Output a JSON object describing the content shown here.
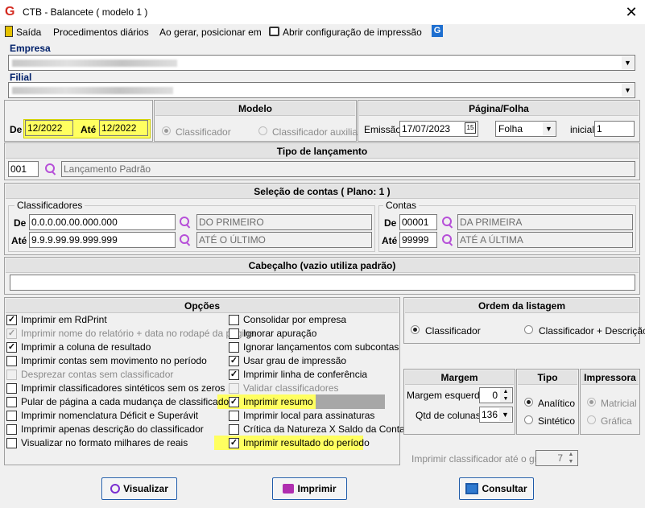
{
  "window": {
    "title": "CTB - Balancete  ( modelo 1 )",
    "close": "✕"
  },
  "menu": [
    "Saída",
    "Procedimentos diários",
    "Ao gerar, posicionar em",
    "Abrir configuração de impressão"
  ],
  "empresa": {
    "label": "Empresa"
  },
  "filial": {
    "label": "Filial"
  },
  "period": {
    "de_label": "De",
    "de_value": "12/2022",
    "ate_label": "Até",
    "ate_value": "12/2022"
  },
  "modelo": {
    "title": "Modelo",
    "options": [
      "Classificador",
      "Classificador auxiliar"
    ]
  },
  "pagina": {
    "title": "Página/Folha",
    "emissao_label": "Emissão",
    "emissao_value": "17/07/2023",
    "cal_icon": "15",
    "folha_value": "Folha",
    "inicial_label": "inicial",
    "inicial_value": "1"
  },
  "tipo_lancamento": {
    "title": "Tipo de lançamento",
    "code": "001",
    "desc": "Lançamento Padrão"
  },
  "selecao": {
    "title": "Seleção de contas  ( Plano: 1 )",
    "classificadores": {
      "legend": "Classificadores",
      "de_label": "De",
      "de_value": "0.0.0.00.00.000.000",
      "de_desc": "DO PRIMEIRO",
      "ate_label": "Até",
      "ate_value": "9.9.9.99.99.999.999",
      "ate_desc": "ATÉ O ÚLTIMO"
    },
    "contas": {
      "legend": "Contas",
      "de_label": "De",
      "de_value": "00001",
      "de_desc": "DA PRIMEIRA",
      "ate_label": "Até",
      "ate_value": "99999",
      "ate_desc": "ATÉ A ÚLTIMA"
    }
  },
  "cabecalho": {
    "title": "Cabeçalho (vazio utiliza padrão)",
    "value": ""
  },
  "opcoes": {
    "title": "Opções",
    "left": [
      {
        "label": "Imprimir em RdPrint",
        "checked": true,
        "enabled": true
      },
      {
        "label": "Imprimir nome do relatório + data no rodapé da página",
        "checked": true,
        "enabled": false
      },
      {
        "label": "Imprimir a coluna de resultado",
        "checked": true,
        "enabled": true
      },
      {
        "label": "Imprimir contas sem movimento no período",
        "checked": false,
        "enabled": true
      },
      {
        "label": "Desprezar contas sem classificador",
        "checked": false,
        "enabled": false
      },
      {
        "label": "Imprimir classificadores sintéticos sem os zeros",
        "checked": false,
        "enabled": true
      },
      {
        "label": "Pular de página a cada mudança de classificador",
        "checked": false,
        "enabled": true
      },
      {
        "label": "Imprimir nomenclatura Déficit e Superávit",
        "checked": false,
        "enabled": true
      },
      {
        "label": "Imprimir apenas descrição do classificador",
        "checked": false,
        "enabled": true
      },
      {
        "label": "Visualizar no formato milhares de reais",
        "checked": false,
        "enabled": true
      }
    ],
    "right": [
      {
        "label": "Consolidar por empresa",
        "checked": false,
        "enabled": true
      },
      {
        "label": "Ignorar apuração",
        "checked": false,
        "enabled": true
      },
      {
        "label": "Ignorar lançamentos com subcontas",
        "checked": false,
        "enabled": true
      },
      {
        "label": "Usar grau de impressão",
        "checked": true,
        "enabled": true
      },
      {
        "label": "Imprimir linha de conferência",
        "checked": true,
        "enabled": true
      },
      {
        "label": "Validar classificadores",
        "checked": false,
        "enabled": false
      },
      {
        "label": "Imprimir resumo",
        "checked": true,
        "enabled": true
      },
      {
        "label": "Imprimir local para assinaturas",
        "checked": false,
        "enabled": true
      },
      {
        "label": "Crítica da Natureza X Saldo da Conta",
        "checked": false,
        "enabled": true
      },
      {
        "label": "Imprimir resultado do período",
        "checked": true,
        "enabled": true
      }
    ]
  },
  "ordem": {
    "title": "Ordem da listagem",
    "options": [
      "Classificador",
      "Classificador + Descrição"
    ]
  },
  "margem": {
    "title": "Margem",
    "esquerda_label": "Margem esquerda",
    "esquerda_value": "0",
    "colunas_label": "Qtd de colunas",
    "colunas_value": "136"
  },
  "tipo": {
    "title": "Tipo",
    "options": [
      "Analítico",
      "Sintético"
    ]
  },
  "impressora": {
    "title": "Impressora",
    "options": [
      "Matricial",
      "Gráfica"
    ]
  },
  "grau": {
    "label": "Imprimir classificador até o grau",
    "value": "7"
  },
  "buttons": {
    "visualizar": "Visualizar",
    "imprimir": "Imprimir",
    "consultar": "Consultar"
  }
}
